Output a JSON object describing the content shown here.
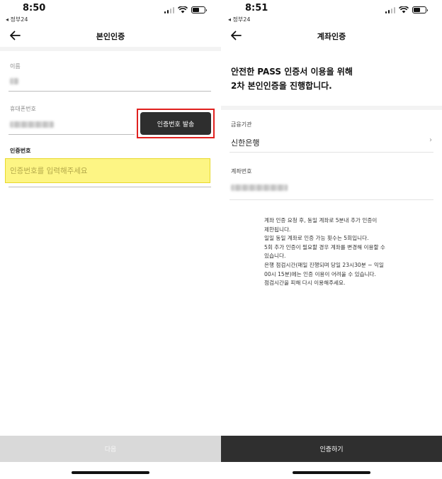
{
  "left": {
    "status": {
      "time": "8:50",
      "back_app": "◂ 정부24"
    },
    "header": {
      "title": "본인인증"
    },
    "fields": {
      "name_label": "이름",
      "phone_label": "휴대폰번호",
      "code_label": "인증번호",
      "code_placeholder": "인증번호를 입력해주세요"
    },
    "send_button": "인증번호 발송",
    "next_button": "다음"
  },
  "right": {
    "status": {
      "time": "8:51",
      "back_app": "◂ 정부24"
    },
    "header": {
      "title": "계좌인증"
    },
    "headline": [
      "안전한 PASS 인증서 이용을 위해",
      "2차 본인인증을 진행합니다."
    ],
    "bank_label": "금융기관",
    "bank_value": "신한은행",
    "account_label": "계좌번호",
    "notice": [
      "계좌 인증 요청 후, 동일 계좌로 5분내 추가 인증이",
      "제한됩니다.",
      "일일 동일 계좌로 인증 가능 횟수는 5회입니다.",
      "5회 추가 인증이 필요할 경우 계좌를 변경해 이용할 수",
      "있습니다.",
      "은행 점검시간(매일 진행되며 당일 23시30분 ~ 익일",
      "00시 15분)에는 인증 이용이 어려울 수 있습니다.",
      "점검시간을 피해 다시 이용해주세요."
    ],
    "verify_button": "인증하기"
  },
  "icons": {
    "back": "arrow-left-icon",
    "chevron": "chevron-right-icon",
    "signal": "cellular-signal-icon",
    "wifi": "wifi-icon",
    "battery": "battery-icon"
  },
  "colors": {
    "highlight_red": "#e0211f",
    "input_highlight": "#fdf584",
    "dark_button": "#2e2e2e",
    "disabled_button": "#d9d9d9"
  }
}
